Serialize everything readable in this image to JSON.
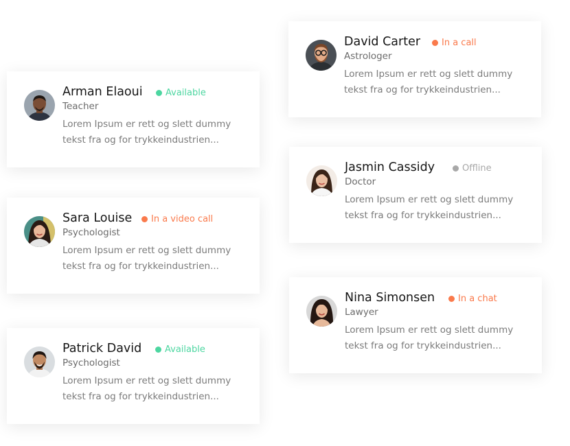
{
  "colors": {
    "available": "#4cd6a0",
    "busy": "#fa7a4c",
    "offline": "#a8a8a8"
  },
  "cards": [
    {
      "name": "Arman Elaoui",
      "role": "Teacher",
      "status": "Available",
      "status_kind": "available",
      "desc_line1": "Lorem Ipsum er rett og slett dummy",
      "desc_line2": "tekst fra og for trykkeindustrien..."
    },
    {
      "name": "Sara Louise",
      "role": "Psychologist",
      "status": "In a video call",
      "status_kind": "busy",
      "desc_line1": "Lorem Ipsum er rett og slett dummy",
      "desc_line2": "tekst fra og for trykkeindustrien..."
    },
    {
      "name": "Patrick David",
      "role": "Psychologist",
      "status": "Available",
      "status_kind": "available",
      "desc_line1": "Lorem Ipsum er rett og slett dummy",
      "desc_line2": "tekst fra og for trykkeindustrien..."
    },
    {
      "name": "David Carter",
      "role": "Astrologer",
      "status": "In a call",
      "status_kind": "busy",
      "desc_line1": "Lorem Ipsum er rett og slett dummy",
      "desc_line2": "tekst fra og for trykkeindustrien..."
    },
    {
      "name": "Jasmin Cassidy",
      "role": "Doctor",
      "status": "Offline",
      "status_kind": "offline",
      "desc_line1": "Lorem Ipsum er rett og slett dummy",
      "desc_line2": "tekst fra og for trykkeindustrien..."
    },
    {
      "name": "Nina Simonsen",
      "role": "Lawyer",
      "status": "In a chat",
      "status_kind": "busy",
      "desc_line1": "Lorem Ipsum er rett og slett dummy",
      "desc_line2": "tekst fra og for trykkeindustrien..."
    }
  ]
}
